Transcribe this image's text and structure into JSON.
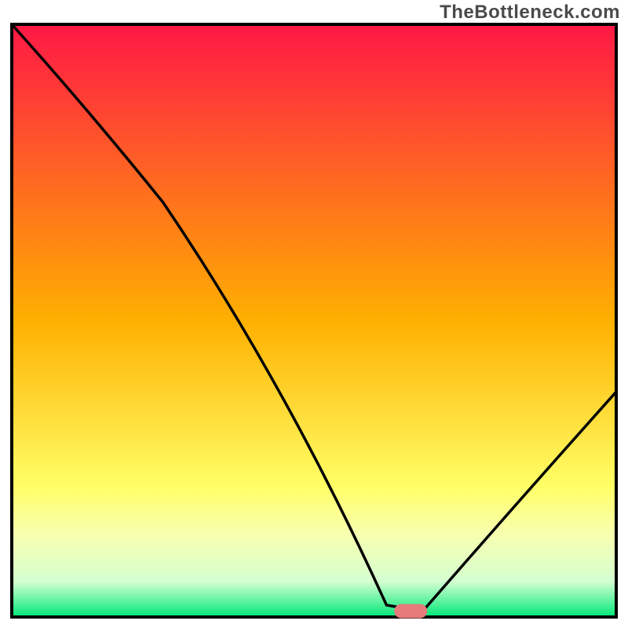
{
  "watermark": "TheBottleneck.com",
  "chart_data": {
    "type": "line",
    "title": "",
    "xlabel": "",
    "ylabel": "",
    "xlim": [
      0,
      100
    ],
    "ylim": [
      0,
      100
    ],
    "grid": false,
    "legend": false,
    "annotations": [],
    "curve": [
      {
        "x": 0,
        "y": 100
      },
      {
        "x": 25,
        "y": 70
      },
      {
        "x": 62,
        "y": 2
      },
      {
        "x": 68,
        "y": 1
      },
      {
        "x": 100,
        "y": 38
      }
    ],
    "marker": {
      "x": 66,
      "y": 1
    },
    "background_gradient": {
      "stops": [
        {
          "offset": 0.0,
          "color": "#ff1846"
        },
        {
          "offset": 0.5,
          "color": "#ffb000"
        },
        {
          "offset": 0.78,
          "color": "#ffff66"
        },
        {
          "offset": 0.86,
          "color": "#f8ffb0"
        },
        {
          "offset": 0.94,
          "color": "#d4ffd0"
        },
        {
          "offset": 1.0,
          "color": "#00e878"
        }
      ]
    },
    "border_color": "#000000",
    "marker_color": "#e77a7a"
  }
}
